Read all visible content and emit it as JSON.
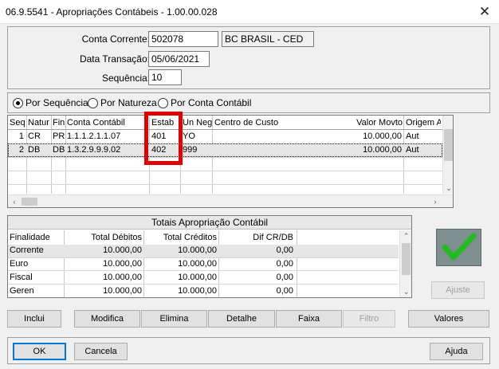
{
  "window": {
    "title": "06.9.5541 - Apropriações Contábeis - 1.00.00.028",
    "close_glyph": "✕"
  },
  "header": {
    "conta_corrente_label": "Conta Corrente:",
    "conta_corrente_value": "502078",
    "conta_corrente_desc": "BC BRASIL - CED",
    "data_transacao_label": "Data Transação:",
    "data_transacao_value": "05/06/2021",
    "sequencia_label": "Sequência:",
    "sequencia_value": "10"
  },
  "sort_options": [
    {
      "label": "Por Sequência",
      "selected": true
    },
    {
      "label": "Por Natureza",
      "selected": false
    },
    {
      "label": "Por Conta Contábil",
      "selected": false
    }
  ],
  "grid": {
    "columns": [
      "Seq",
      "Natur",
      "Fin",
      "Conta Contábil",
      "Estab",
      "Un Neg",
      "Centro de Custo",
      "Valor Movto",
      "Origem A"
    ],
    "rows": [
      {
        "seq": "1",
        "natur": "CR",
        "fin": "PR",
        "conta": "1.1.1.2.1.1.07",
        "estab": "401",
        "un_neg": "YO",
        "centro": "",
        "valor": "10.000,00",
        "origem": "Aut"
      },
      {
        "seq": "2",
        "natur": "DB",
        "fin": "DB",
        "conta": "1.3.2.9.9.9.02",
        "estab": "402",
        "un_neg": "999",
        "centro": "",
        "valor": "10.000,00",
        "origem": "Aut"
      }
    ],
    "highlight_color": "#e00000"
  },
  "totals": {
    "title": "Totais Apropriação Contábil",
    "columns": [
      "Finalidade",
      "Total Débitos",
      "Total Créditos",
      "Dif CR/DB"
    ],
    "rows": [
      {
        "finalidade": "Corrente",
        "debitos": "10.000,00",
        "creditos": "10.000,00",
        "dif": "0,00"
      },
      {
        "finalidade": "Euro",
        "debitos": "10.000,00",
        "creditos": "10.000,00",
        "dif": "0,00"
      },
      {
        "finalidade": "Fiscal",
        "debitos": "10.000,00",
        "creditos": "10.000,00",
        "dif": "0,00"
      },
      {
        "finalidade": "Geren",
        "debitos": "10.000,00",
        "creditos": "10.000,00",
        "dif": "0,00"
      }
    ]
  },
  "side": {
    "ajuste_label": "Ajuste",
    "check_color": "#22bb22"
  },
  "actions": {
    "inclui": "Inclui",
    "modifica": "Modifica",
    "elimina": "Elimina",
    "detalhe": "Detalhe",
    "faixa": "Faixa",
    "filtro": "Filtro",
    "valores": "Valores"
  },
  "footer": {
    "ok": "OK",
    "cancela": "Cancela",
    "ajuda": "Ajuda"
  }
}
